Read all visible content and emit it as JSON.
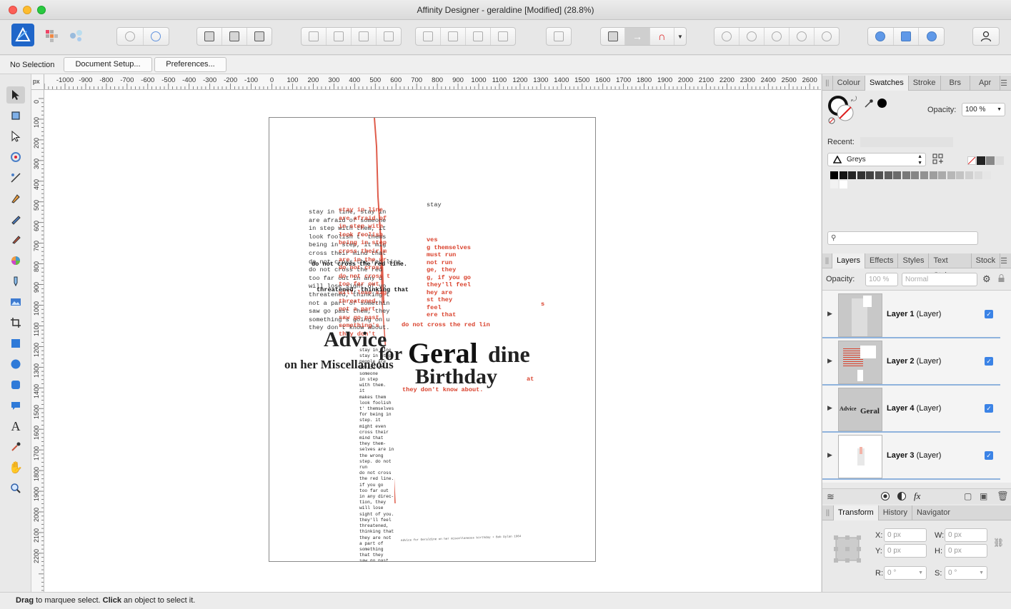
{
  "window": {
    "title": "Affinity Designer - geraldine [Modified] (28.8%)"
  },
  "context_bar": {
    "selection": "No Selection",
    "document_setup": "Document Setup...",
    "preferences": "Preferences..."
  },
  "ruler": {
    "unit": "px",
    "h_labels": [
      "-1000",
      "-900",
      "-800",
      "-700",
      "-600",
      "-500",
      "-400",
      "-300",
      "-200",
      "-100",
      "0",
      "100",
      "200",
      "300",
      "400",
      "500",
      "600",
      "700",
      "800",
      "900",
      "1000",
      "1100",
      "1200",
      "1300",
      "1400",
      "1500",
      "1600",
      "1700",
      "1800",
      "1900",
      "2000",
      "2100",
      "2200",
      "2300",
      "2400",
      "2500",
      "2600"
    ],
    "v_labels": [
      "0",
      "100",
      "200",
      "300",
      "400",
      "500",
      "600",
      "700",
      "800",
      "900",
      "1000",
      "1100",
      "1200",
      "1300",
      "1400",
      "1500",
      "1600",
      "1700",
      "1800",
      "1900",
      "2000",
      "2100",
      "2200"
    ]
  },
  "document": {
    "poem_black": "stay in line, stay in\nare afraid of someone\nin step with them, it\nlook foolish t' thems\nbeing in step, it mig\ncross their mind that\ndo not cross the red line.\ndo not cross the red\ntoo far out in any d\nwill lose sight of yo\nthreatened, thinking t\nnot a part of somethin\nsaw go past them, they\nsomething's going on u\nthey don't know about.",
    "poem_red": "stay in line\nare afraid of\nin step with\nlook foolish\nbeing in step\ncross their m\nare in the wr\ndo not cross\ndo not cross t\ntoo far out\nwill lose sig\nthreatened,\nnot a part\nsaw go past\nsomething's\nthey don't",
    "line_bold_1": "do not cross the red line.",
    "line_bold_2": "threatened, thinking that",
    "stay_fragment": "stay",
    "right_red": "ves\ng themselves\nmust run\nnot run\nge, they\ng, if you go\nthey'll feel\nhey are\nst they\nfeel\nere that",
    "red_line_2": "do not cross the red lin",
    "red_s": "s",
    "red_at": "at",
    "red_bottom": "they don't know about.",
    "narrow_column": "stay in line\nstay in step\npeople are\nafraid of\nsomeone\nin step\nwith them.\nit\nmakes them\nlook foolish\nt' themselves\nfor being in\nstep. it\nmight even\ncross their\nmind that\nthey them-\nselves are in\nthe wrong\nstep. do not\nrun\ndo not cross\nthe red line.\nif you go\ntoo far out\nin any direc-\ntion, they\nwill lose\nsight of you.\nthey'll feel\nthreatened,\nthinking that\nthey are not\na part of\nsomething\nthat they\nsaw go past\nthem. they'll\nfeel\nsomething's\ngoing on up\nthere that\nthey don't\nknow about.",
    "title_advice": "Advice",
    "title_for": "for",
    "title_geral": "Geral",
    "title_dine": "dine",
    "title_misc": "on her Miscellaneous",
    "title_birthday": "Birthday",
    "footer": "Advice for Geraldine on her miscellaneous birthday • Bob Dylan 1964"
  },
  "status": {
    "bold1": "Drag",
    "text1": " to marquee select. ",
    "bold2": "Click",
    "text2": " an object to select it."
  },
  "colour_panel": {
    "tabs": [
      "Colour",
      "Swatches",
      "Stroke",
      "Brs",
      "Apr"
    ],
    "selected_tab": "Swatches",
    "opacity_label": "Opacity:",
    "opacity_value": "100 %",
    "recent_label": "Recent:",
    "palette_name": "Greys",
    "greys": [
      "#000000",
      "#141414",
      "#242424",
      "#333333",
      "#424242",
      "#505050",
      "#5e5e5e",
      "#6b6b6b",
      "#787878",
      "#858585",
      "#929292",
      "#9e9e9e",
      "#ababab",
      "#b7b7b7",
      "#c3c3c3",
      "#cfcfcf",
      "#dbdbdb",
      "#e6e6e6",
      "#f2f2f2",
      "#ffffff"
    ]
  },
  "layers_panel": {
    "tabs": [
      "Layers",
      "Effects",
      "Styles",
      "Text Styles",
      "Stock"
    ],
    "selected_tab": "Layers",
    "opacity_label": "Opacity:",
    "opacity_value": "100 %",
    "blend": "Normal",
    "layers": [
      {
        "name": "Layer 1",
        "type": "(Layer)"
      },
      {
        "name": "Layer 2",
        "type": "(Layer)"
      },
      {
        "name": "Layer 4",
        "type": "(Layer)"
      },
      {
        "name": "Layer 3",
        "type": "(Layer)"
      }
    ],
    "thumb_text": {
      "advice": "Advice",
      "geral": "Geral"
    }
  },
  "transform_panel": {
    "tabs": [
      "Transform",
      "History",
      "Navigator"
    ],
    "selected_tab": "Transform",
    "x_label": "X:",
    "y_label": "Y:",
    "w_label": "W:",
    "h_label": "H:",
    "r_label": "R:",
    "s_label": "S:",
    "x": "0 px",
    "y": "0 px",
    "w": "0 px",
    "h": "0 px",
    "r": "0 °",
    "s": "0 °"
  }
}
